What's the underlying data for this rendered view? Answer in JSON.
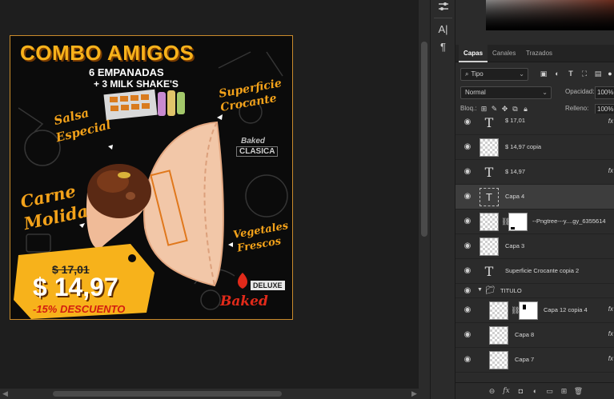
{
  "artwork": {
    "title": "COMBO AMIGOS",
    "subtitle_line1": "6 EMPANADAS",
    "subtitle_line2": "+ 3 MILK SHAKE'S",
    "label_salsa_1": "Salsa",
    "label_salsa_2": "Especial",
    "label_superficie_1": "Superficie",
    "label_superficie_2": "Crocante",
    "label_carne_1": "Carne",
    "label_carne_2": "Molida",
    "label_vegetales_1": "Vegetales",
    "label_vegetales_2": "Frescos",
    "price_old": "$ 17,01",
    "price_new": "$ 14,97",
    "discount": "-15% DESCUENTO",
    "brand": "Baked",
    "brand_deluxe": "DELUXE",
    "brand_clasica": "CLASICA",
    "brand_baked_small": "Baked",
    "colors": {
      "orange": "#f7b21b",
      "red": "#e12a1a",
      "frame": "#c98a2b"
    }
  },
  "toolstrip": {
    "top_icon": "sliders-icon",
    "char_icon": "A|",
    "para_icon": "¶"
  },
  "panel": {
    "tabs": [
      {
        "label": "Capas"
      },
      {
        "label": "Canales"
      },
      {
        "label": "Trazados"
      }
    ],
    "filter": {
      "selected": "Tipo"
    },
    "blend": {
      "selected": "Normal"
    },
    "opacity": {
      "label": "Opacidad:",
      "value": "100%"
    },
    "lock": {
      "label": "Bloq.:"
    },
    "fill": {
      "label": "Relleno:",
      "value": "100%"
    },
    "layers": [
      {
        "name": "$ 17,01",
        "kind": "type",
        "fx": "fx"
      },
      {
        "name": "$ 14,97 copia",
        "kind": "raster",
        "fx": ""
      },
      {
        "name": "$ 14,97",
        "kind": "type",
        "fx": "fx"
      },
      {
        "name": "Capa 4",
        "kind": "selected-thumb",
        "fx": ""
      },
      {
        "name": "--Pngtree---y....gy_6355614",
        "kind": "masked",
        "fx": ""
      },
      {
        "name": "Capa 3",
        "kind": "raster",
        "fx": ""
      },
      {
        "name": "Superficie Crocante copia 2",
        "kind": "type",
        "fx": ""
      },
      {
        "name": "TITULO",
        "kind": "folder",
        "fx": ""
      },
      {
        "name": "Capa 12 copia 4",
        "kind": "masked-indent",
        "fx": "fx"
      },
      {
        "name": "Capa 8",
        "kind": "raster-indent",
        "fx": "fx"
      },
      {
        "name": "Capa 7",
        "kind": "raster-indent",
        "fx": "fx"
      }
    ],
    "footer_icons": [
      "link-icon",
      "fx-icon",
      "mask-icon",
      "adjustment-icon",
      "folder-icon",
      "new-layer-icon",
      "trash-icon"
    ]
  }
}
